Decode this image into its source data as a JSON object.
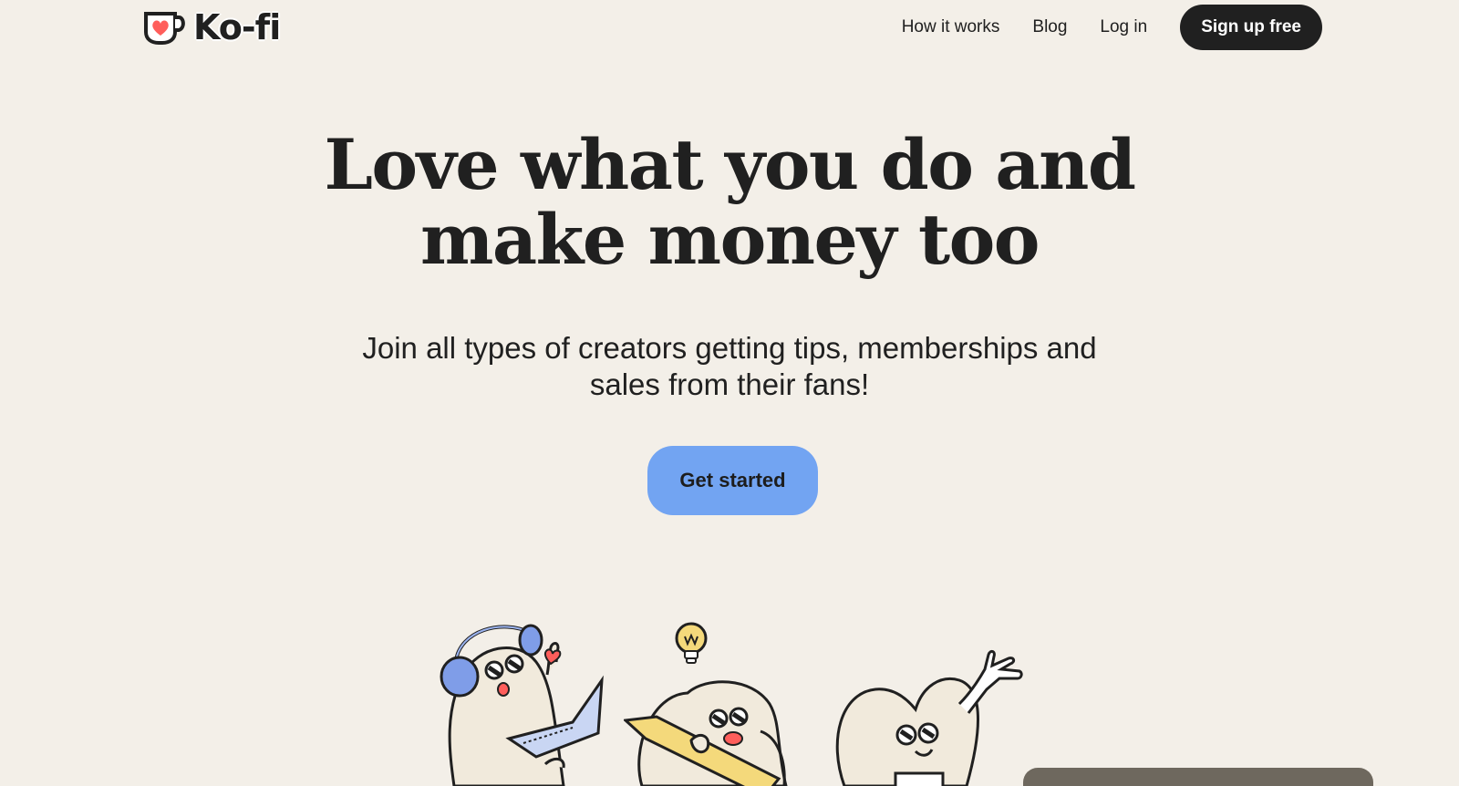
{
  "brand": {
    "name": "Ko-fi",
    "heart_color": "#ff5e5b"
  },
  "nav": {
    "how_it_works": "How it works",
    "blog": "Blog",
    "log_in": "Log in",
    "sign_up": "Sign up free"
  },
  "hero": {
    "headline_line1": "Love what you do and",
    "headline_line2": "make money too",
    "subtitle": "Join all types of creators getting tips, memberships and sales from their fans!",
    "cta": "Get started"
  },
  "colors": {
    "background": "#f3efe8",
    "cta": "#72a4f2",
    "dark": "#202020"
  }
}
